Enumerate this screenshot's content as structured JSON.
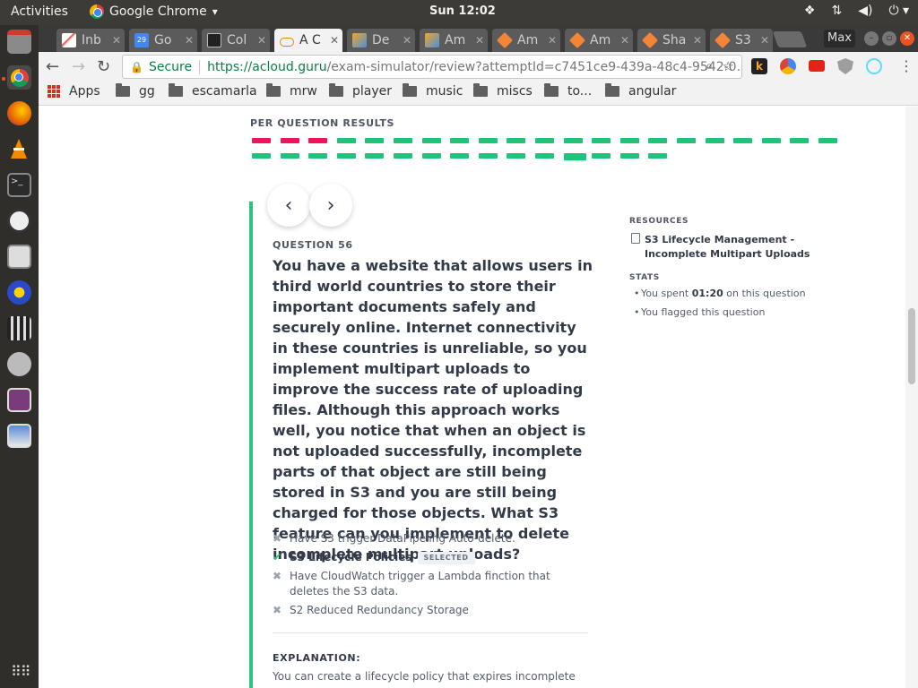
{
  "desktop": {
    "activities_label": "Activities",
    "app_menu_label": "Google Chrome",
    "app_menu_arrow": "▾",
    "clock": "Sun 12:02",
    "tray_icons": [
      "dropbox-icon",
      "network-icon",
      "volume-icon",
      "power-icon"
    ]
  },
  "browser": {
    "tabs": [
      {
        "label": "Inb",
        "icon": "gmail-icon",
        "active": false
      },
      {
        "label": "Go",
        "icon": "calendar-icon",
        "active": false
      },
      {
        "label": "Col",
        "icon": "clapper-icon",
        "active": false
      },
      {
        "label": "A C",
        "icon": "cloud-guru-icon",
        "active": true
      },
      {
        "label": "De",
        "icon": "cube-icon",
        "active": false
      },
      {
        "label": "Am",
        "icon": "cube-icon",
        "active": false
      },
      {
        "label": "Am",
        "icon": "aws-icon",
        "active": false
      },
      {
        "label": "Am",
        "icon": "aws-icon",
        "active": false
      },
      {
        "label": "Sha",
        "icon": "aws-icon",
        "active": false
      },
      {
        "label": "S3",
        "icon": "aws-icon",
        "active": false
      }
    ],
    "tab_close_glyph": "✕",
    "window_label": "Max",
    "address": {
      "secure_label": "Secure",
      "url_host": "https://acloud.guru",
      "url_path": "/exam-simulator/review?attemptId=c7451ce9-439a-48c4-9542-0..."
    },
    "bookmarks": [
      "Apps",
      "gg",
      "escamarla",
      "mrw",
      "player",
      "music",
      "miscs",
      "to...",
      "angular"
    ]
  },
  "page": {
    "per_question_label": "PER QUESTION RESULTS",
    "results": {
      "row1": [
        "wrong",
        "wrong",
        "wrong",
        "right",
        "right",
        "right",
        "right",
        "right",
        "right",
        "right",
        "right",
        "right",
        "right",
        "right",
        "right",
        "right",
        "right",
        "right",
        "right",
        "right",
        "right"
      ],
      "row2": [
        "right",
        "right",
        "right",
        "right",
        "right",
        "right",
        "right",
        "right",
        "right",
        "right",
        "right",
        "current",
        "right",
        "right",
        "right"
      ]
    },
    "colors": {
      "right": "#1fc47a",
      "wrong": "#f0145a",
      "accent": "#2ac47a"
    },
    "nav": {
      "prev_glyph": "‹",
      "next_glyph": "›"
    },
    "question": {
      "number_label": "QUESTION 56",
      "text": "You have a website that allows users in third world countries to store their important documents safely and securely online. Internet connectivity in these countries is unreliable, so you implement multipart uploads to improve the success rate of uploading files. Although this approach works well, you notice that when an object is not uploaded successfully, incomplete parts of that object are still being stored in S3 and you are still being charged for those objects. What S3 feature can you implement to delete incomplete multipart uploads?",
      "answers": [
        {
          "mark": "✖",
          "text": "Have S3 trigger DataPipeling Auto-delete.",
          "correct": false,
          "selected": false
        },
        {
          "mark": "✔",
          "text": "S3 Lifecycle Policies",
          "correct": true,
          "selected": true,
          "badge": "SELECTED"
        },
        {
          "mark": "✖",
          "text": "Have CloudWatch trigger a Lambda finction that deletes the S3 data.",
          "correct": false,
          "selected": false
        },
        {
          "mark": "✖",
          "text": "S2 Reduced Redundancy Storage",
          "correct": false,
          "selected": false
        }
      ],
      "explanation_heading": "EXPLANATION:",
      "explanation": "You can create a lifecycle policy that expires incomplete"
    },
    "side": {
      "resources_heading": "RESOURCES",
      "resource_link": "S3 Lifecycle Management - Incomplete Multipart Uploads",
      "stats_heading": "STATS",
      "stat_time_prefix": "You spent",
      "stat_time_value": "01:20",
      "stat_time_suffix": "on this question",
      "stat_flag": "You flagged this question"
    }
  }
}
